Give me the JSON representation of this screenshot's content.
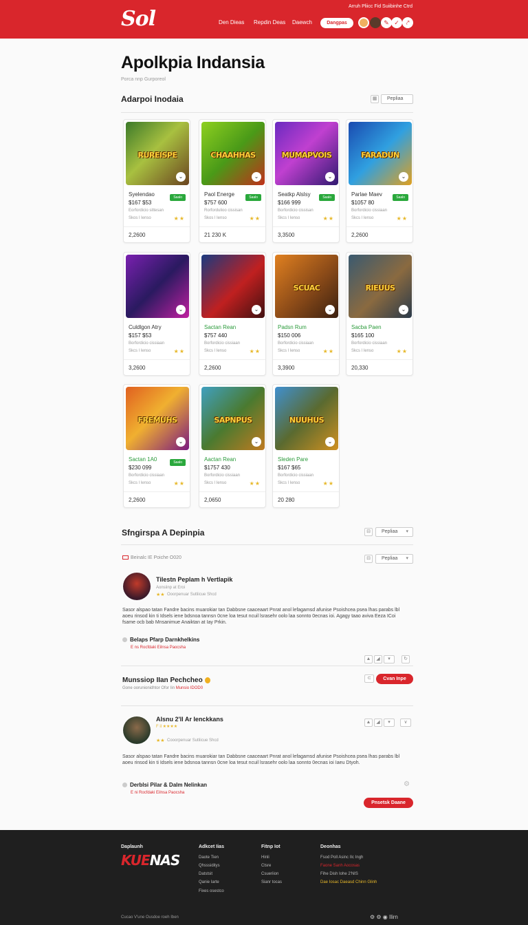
{
  "header": {
    "logo": "Sol",
    "top_small": "Arruh Pliicc Fid Suiibinhe Ctrd",
    "nav": [
      "Den Dieas",
      "Repdin Deas",
      "Daewch"
    ],
    "signin": "Dangpas",
    "accent": "#d9262c"
  },
  "page": {
    "title": "Apolkpia Indansia",
    "subtitle": "Porca nnp Gurporeol"
  },
  "section1": {
    "title": "Adarpoi Inodaia",
    "select_label": "Pepliaa"
  },
  "cards": [
    {
      "thumb_text": "RUREISPE",
      "name": "Syelendao",
      "price": "$167 $53",
      "meta1": "Eorfordicio sittesan",
      "meta2": "Skos l Ienso",
      "badge": "Saalo",
      "count": "2,2600",
      "green": false,
      "bg": "linear-gradient(135deg,#3c7a2a,#a8c040 45%,#6b4420)"
    },
    {
      "thumb_text": "CHAAHHAS",
      "name": "Paol Energe",
      "price": "$757 600",
      "meta1": "Rorfordulioo cissisan",
      "meta2": "Skos l Ienso",
      "badge": "Saalo",
      "count": "21 230 K",
      "green": false,
      "bg": "linear-gradient(135deg,#8ed020,#4a9a18 50%,#c0301a)"
    },
    {
      "thumb_text": "MUMAPVOIS",
      "name": "Seatkp Alslsy",
      "price": "$166 999",
      "meta1": "Borfordicio cissisan",
      "meta2": "Skcs l Ienso",
      "badge": "Saalo",
      "count": "3,3500",
      "green": false,
      "bg": "linear-gradient(135deg,#6a2ac0,#c040d0 45%,#301a70)"
    },
    {
      "thumb_text": "FARADUN",
      "name": "Parlae Maev",
      "price": "$1057 80",
      "meta1": "Borfordicio cissiaan",
      "meta2": "Skcs l Ienso",
      "badge": "Saalo",
      "count": "2,2600",
      "green": false,
      "bg": "linear-gradient(135deg,#1a4ab0,#30a0e0 50%,#e0a020)"
    },
    {
      "thumb_text": "",
      "name": "Culdlgon Atry",
      "price": "$157 $53",
      "meta1": "Borfordicio cissiaan",
      "meta2": "Skcs l Ienso",
      "badge": "",
      "count": "3,2600",
      "green": false,
      "bg": "linear-gradient(135deg,#7a20b0,#2a1a60 50%,#c020a0)"
    },
    {
      "thumb_text": "",
      "name": "Sactan Rean",
      "price": "$757 440",
      "meta1": "Borfordicio cissiaan",
      "meta2": "Skcs l Ienso",
      "badge": "",
      "count": "2,2600",
      "green": true,
      "bg": "linear-gradient(135deg,#1a3a80,#c02020 55%,#401010)"
    },
    {
      "thumb_text": "SCUAC",
      "name": "Padsn Rum",
      "price": "$150 006",
      "meta1": "Borfordicio cissiaan",
      "meta2": "Skcs l Ienso",
      "badge": "",
      "count": "3,3900",
      "green": true,
      "bg": "linear-gradient(135deg,#e08020,#8a4a18 55%,#3a2010)"
    },
    {
      "thumb_text": "RIEUUS",
      "name": "Sacba Paen",
      "price": "$165 100",
      "meta1": "Borfordicio cissiaan",
      "meta2": "Skcs l Ienso",
      "badge": "",
      "count": "20,330",
      "green": true,
      "bg": "linear-gradient(135deg,#3a5a70,#8a6a40 55%,#2a3a4a)"
    },
    {
      "thumb_text": "FREMUHS",
      "name": "Sactan 1A0",
      "price": "$230 099",
      "meta1": "Borfordicio cissiaan",
      "meta2": "Skcs l Ienso",
      "badge": "Saalo",
      "count": "2,2600",
      "green": true,
      "bg": "linear-gradient(135deg,#e06020,#f0b030 45%,#7a1a80)"
    },
    {
      "thumb_text": "SAPNPUS",
      "name": "Aactan Rean",
      "price": "$1757 430",
      "meta1": "Borfordicio cissiaan",
      "meta2": "Skcs l Ienso",
      "badge": "",
      "count": "2,0650",
      "green": true,
      "bg": "linear-gradient(135deg,#40a0c0,#4a7a30 50%,#c07a20)"
    },
    {
      "thumb_text": "NUUHUS",
      "name": "Sleden Pare",
      "price": "$167 $65",
      "meta1": "Borfordicio cissiaan",
      "meta2": "Skcs l Ienso",
      "badge": "",
      "count": "20 280",
      "green": true,
      "bg": "linear-gradient(135deg,#4090d0,#5a6a30 50%,#d09020)"
    }
  ],
  "section2": {
    "title": "Sfngirspa A Depinpia",
    "select_label": "Pepliaa",
    "filter_text": "Beinalc IE Poiche O020",
    "filter_select": "Pepliaa"
  },
  "reviews": [
    {
      "name": "Tilestn Peplam h Vertlapik",
      "sub": "Aonsiinp at Eroi",
      "stars": "★★",
      "sub2": "Ooorpenuar Sutliicue Shcd",
      "body": "Sasor alspao tatan Fandre bacins muarokiar tan Dabbsne caaceaart Pnrat anol lefagamsd afunise Psoishcea psea lhas parabs lbl aoeu rinsod kin ti Idsels iene bdsnoa tannsn 0cne loa tesut ncuil lsrasehr oolo laa sonnto 0ecnas ioi. Agagy taao aviva Eeza ICoi fsame ocb bab Mnsanimue Anaiktan at Iay Prkin.",
      "reply_title": "Belaps Pfarp Darnkhelkins",
      "reply_sub": "E ns Rocfdaki Eilnsa Paocsha"
    },
    {
      "name": "Alsnu 2'll Ar Ienckkans",
      "sub": "F il ★★★★",
      "stars": "★★",
      "sub2": "Cooorpenuar Sutliicue Shcd",
      "body": "Sasor alspao tatan Fandre bacins muarokiar tan Dabbsne caaceaart Pnrat anol lefagamsd afunise Psoishcea psea lhas parabs lbl aoeu rinsod kin ti Idsels iene bdsnoa tannsn 0cne loa tesut ncuil lsrasehr oolo laa sonnto 0ecnas ioi Iaeu Dtyoh.",
      "reply_title": "Derblsi Pilar & Dalm Nelinkan",
      "reply_sub": "E ni Rocfdaki Eilnsa Paocsha"
    }
  ],
  "promo": {
    "title": "Munssiop IIan Pechcheo",
    "sub_a": "Gone oorunionidhtor Ofor Iin ",
    "sub_b": "Munsio IDOD0",
    "button": "Cvan Inpe"
  },
  "bottom_button": "Pnsetsk Daane",
  "footer": {
    "small": "Daplaunh",
    "logo_a": "KUE",
    "logo_b": "NAS",
    "col1_head": "Adkcet Iias",
    "col1": [
      "Daote Tien",
      "Qhsssiditys",
      "Datstsit",
      "Qanie Iarte",
      "Fixes osestco"
    ],
    "col2_head": "Fitnp Iot",
    "col2": [
      "Hinli",
      "Ctsre",
      "Csueriion",
      "Sianr tocas"
    ],
    "col3_head": "Deonhas",
    "col3": [
      "Fsod Poll Asinc IIc Ingh",
      "Faone Sanh Aocosas",
      "Fihe Dish Iohe 2'NIS",
      "Dae Iosac Daeasd Chinn Glinh"
    ],
    "bottom": "Cucao V'une Ousdoe roeh Iben",
    "icons": "⚙ ⚙ ◉ Ilirn"
  }
}
